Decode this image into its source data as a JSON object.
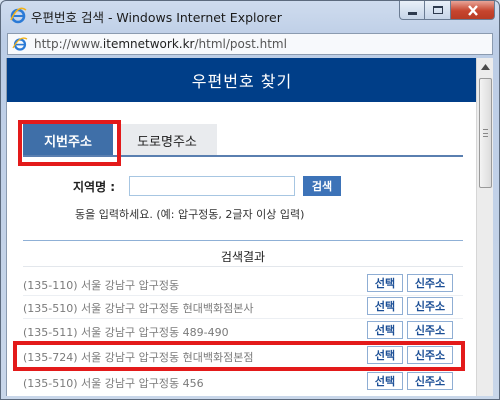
{
  "window": {
    "title": "우편번호 검색 - Windows Internet Explorer",
    "url_prefix": "http://www.",
    "url_domain": "itemnetwork.kr",
    "url_path": "/html/post.html"
  },
  "page": {
    "header_title": "우편번호 찾기",
    "tabs": [
      {
        "label": "지번주소",
        "active": true
      },
      {
        "label": "도로명주소",
        "active": false
      }
    ],
    "region_label": "지역명 :",
    "region_input_value": "",
    "search_button": "검색",
    "help_text": "동을 입력하세요. (예: 압구정동, 2글자 이상 입력)",
    "results_title": "검색결과",
    "select_label": "선택",
    "new_address_label": "신주소",
    "results": [
      {
        "text": "(135-110) 서울 강남구 압구정동"
      },
      {
        "text": "(135-510) 서울 강남구 압구정동 현대백화점본사"
      },
      {
        "text": "(135-511) 서울 강남구 압구정동 489-490"
      },
      {
        "text": "(135-724) 서울 강남구 압구정동 현대백화점본점"
      },
      {
        "text": "(135-510) 서울 강남구 압구정동 456"
      }
    ]
  },
  "colors": {
    "header": "#003e88",
    "active_tab": "#3f6fa8",
    "highlight": "#e31a1a",
    "button_text": "#1c4f96"
  },
  "icons": [
    "ie-logo-icon",
    "page-icon",
    "minimize-icon",
    "maximize-icon",
    "close-icon",
    "scroll-up-icon"
  ]
}
